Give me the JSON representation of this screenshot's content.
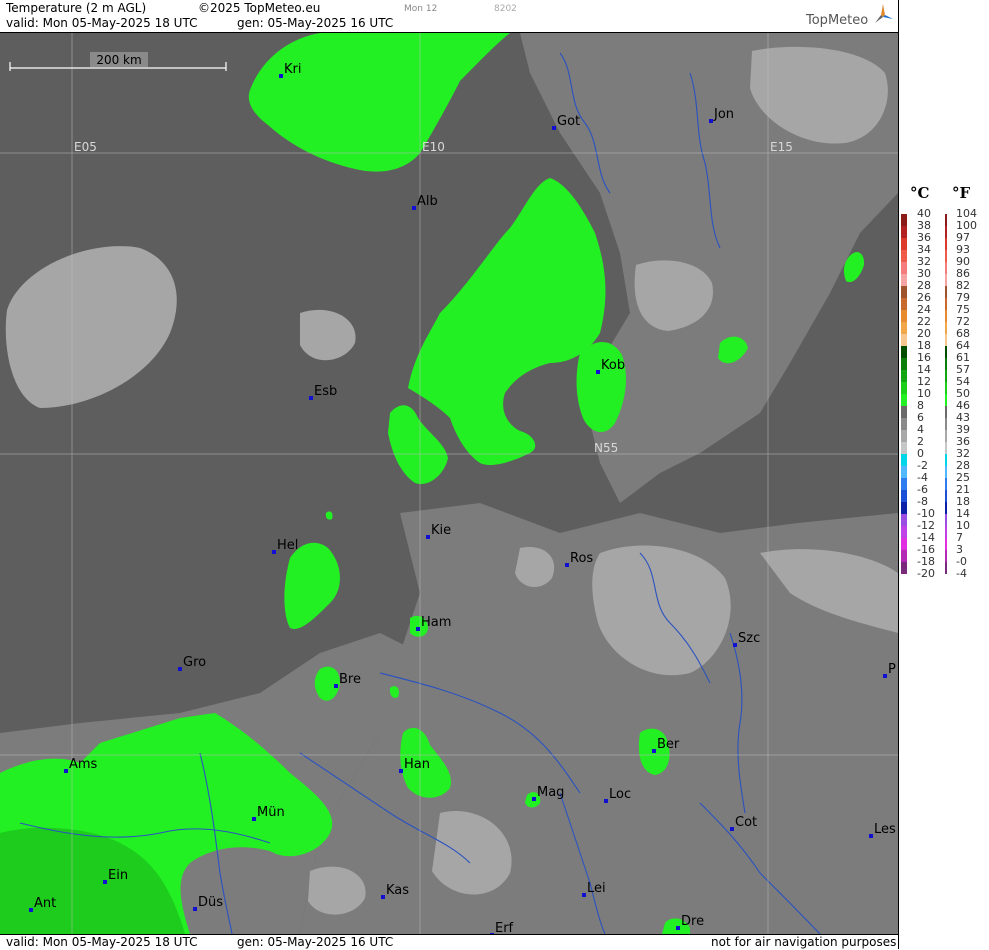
{
  "header": {
    "product": "Temperature (2 m AGL)",
    "copyright": "©2025 TopMeteo.eu",
    "run_code": "Mon 12",
    "run_num": "8202",
    "valid_line": "valid:  Mon  05-May-2025  18 UTC",
    "gen_line": "gen: 05-May-2025 16 UTC",
    "brand": "TopMeteo"
  },
  "footer": {
    "valid_line": "valid:  Mon  05-May-2025  18 UTC",
    "gen_line": "gen: 05-May-2025 16 UTC",
    "disclaimer": "not for air navigation purposes"
  },
  "scale_bar": {
    "label": "200 km"
  },
  "grid_labels": [
    "E05",
    "E10",
    "E15",
    "N55"
  ],
  "cities": [
    {
      "label": "Kri"
    },
    {
      "label": "Got"
    },
    {
      "label": "Jon"
    },
    {
      "label": "Alb"
    },
    {
      "label": "Esb"
    },
    {
      "label": "Kob"
    },
    {
      "label": "Kie"
    },
    {
      "label": "Hel"
    },
    {
      "label": "Ros"
    },
    {
      "label": "Ham"
    },
    {
      "label": "Szc"
    },
    {
      "label": "Gro"
    },
    {
      "label": "Bre"
    },
    {
      "label": "P"
    },
    {
      "label": "Ber"
    },
    {
      "label": "Ams"
    },
    {
      "label": "Han"
    },
    {
      "label": "Mag"
    },
    {
      "label": "Loc"
    },
    {
      "label": "Mün"
    },
    {
      "label": "Cot"
    },
    {
      "label": "Les"
    },
    {
      "label": "Ein"
    },
    {
      "label": "Kas"
    },
    {
      "label": "Lei"
    },
    {
      "label": "Ant"
    },
    {
      "label": "Düs"
    },
    {
      "label": "Dre"
    },
    {
      "label": "Erf"
    }
  ],
  "legend": {
    "celsius_unit": "°C",
    "fahrenheit_unit": "°F",
    "celsius": [
      "40",
      "38",
      "36",
      "34",
      "32",
      "30",
      "28",
      "26",
      "24",
      "22",
      "20",
      "18",
      "16",
      "14",
      "12",
      "10",
      "8",
      "6",
      "4",
      "2",
      "0",
      "-2",
      "-4",
      "-6",
      "-8",
      "-10",
      "-12",
      "-14",
      "-16",
      "-18",
      "-20"
    ],
    "fahrenheit": [
      "104",
      "100",
      "97",
      "93",
      "90",
      "86",
      "82",
      "79",
      "75",
      "72",
      "68",
      "64",
      "61",
      "57",
      "54",
      "50",
      "46",
      "43",
      "39",
      "36",
      "32",
      "28",
      "25",
      "21",
      "18",
      "14",
      "10",
      "7",
      "3",
      "-0",
      "-4"
    ],
    "colors": [
      "#8b1a1a",
      "#b22222",
      "#dc3b2b",
      "#f05a4a",
      "#f47c7c",
      "#f5a3a3",
      "#a0522d",
      "#c8692e",
      "#e88a2e",
      "#f2a64a",
      "#f6c88f",
      "#004d00",
      "#0a7d0a",
      "#12a612",
      "#1bcf1b",
      "#22f022",
      "#6a6a6a",
      "#8a8a8a",
      "#a8a8a8",
      "#c6c6c6",
      "#00d6e8",
      "#4fb8ff",
      "#2e7cf0",
      "#1a4fd6",
      "#0d1fa8",
      "#9a4de0",
      "#c042e6",
      "#e02ee0",
      "#b52ab5",
      "#7a2a7a"
    ]
  }
}
